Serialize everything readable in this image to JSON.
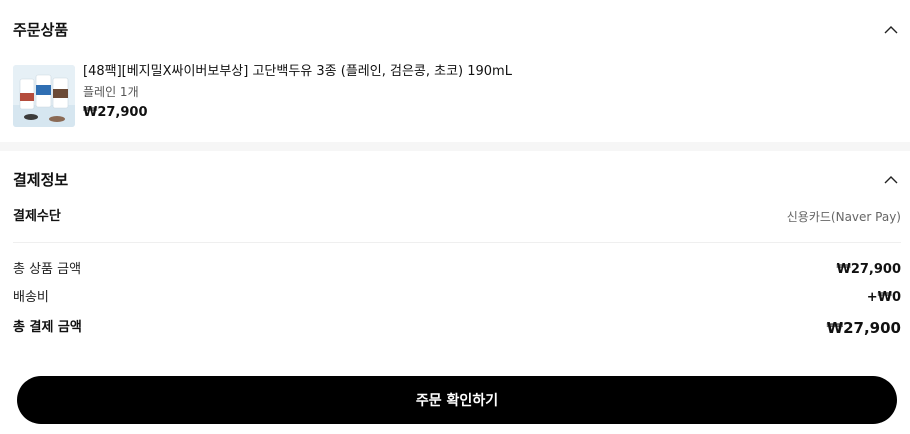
{
  "order_section": {
    "title": "주문상품",
    "toggle_icon": "chevron-up-icon",
    "product": {
      "thumbnail_icon": "product-thumbnail",
      "name": "[48팩][베지밀X싸이버보부상] 고단백두유 3종 (플레인, 검은콩, 초코) 190mL",
      "option": "플레인 1개",
      "price": "₩27,900"
    }
  },
  "payment_section": {
    "title": "결제정보",
    "toggle_icon": "chevron-up-icon",
    "method_label": "결제수단",
    "method_value": "신용카드(Naver Pay)",
    "product_total_label": "총 상품 금액",
    "product_total_value": "₩27,900",
    "shipping_label": "배송비",
    "shipping_value": "+₩0",
    "grand_total_label": "총 결제 금액",
    "grand_total_value": "₩27,900"
  },
  "confirm_button": {
    "label": "주문 확인하기"
  },
  "colors": {
    "button_bg": "#000000",
    "section_gap": "#f6f6f6"
  }
}
